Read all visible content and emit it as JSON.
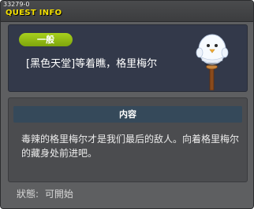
{
  "window": {
    "quest_id": "33279-0",
    "title": "QUEST INFO"
  },
  "quest": {
    "category": "一般",
    "name": "[黑色天堂]等着瞧，格里梅尔",
    "npc_icon": "snowman-on-post-icon"
  },
  "content": {
    "header": "内容",
    "description": "毒辣的格里梅尔才是我们最后的敌人。向着格里梅尔的藏身处前进吧。"
  },
  "status": {
    "label": "狀態:",
    "value": "可開始"
  },
  "colors": {
    "title": "#f4e000",
    "badge": "#8fb813",
    "panel": "#33394a",
    "header": "#35495a"
  }
}
